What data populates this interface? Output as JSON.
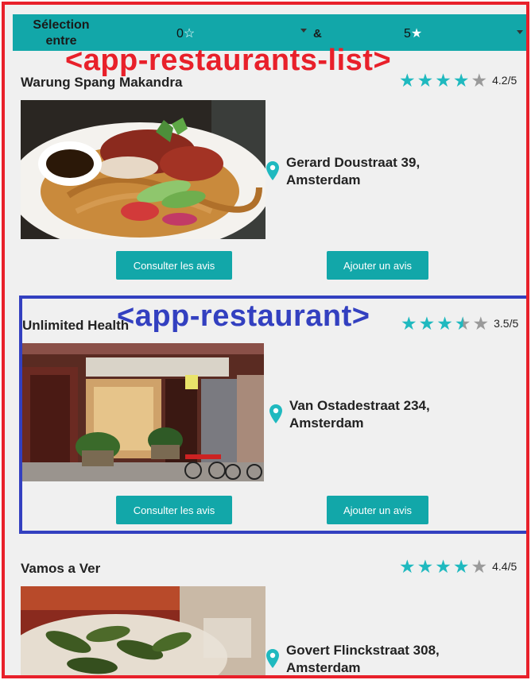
{
  "overlays": {
    "list_component": "<app-restaurants-list>",
    "item_component": "<app-restaurant>"
  },
  "filter": {
    "label": "Sélection entre",
    "min_value": "0",
    "min_icon": "empty-star-icon",
    "separator": "&",
    "max_value": "5",
    "max_icon": "filled-star-icon"
  },
  "common": {
    "view_reviews_label": "Consulter les avis",
    "add_review_label": "Ajouter un avis",
    "location_icon": "map-pin-icon"
  },
  "restaurants": [
    {
      "name": "Warung Spang Makandra",
      "rating": 4.2,
      "rating_text": "4.2/5",
      "address_line1": "Gerard Doustraat 39,",
      "address_line2": "Amsterdam"
    },
    {
      "name": "Unlimited Health",
      "rating": 3.5,
      "rating_text": "3.5/5",
      "address_line1": "Van Ostadestraat 234,",
      "address_line2": "Amsterdam"
    },
    {
      "name": "Vamos a Ver",
      "rating": 4.4,
      "rating_text": "4.4/5",
      "address_line1": "Govert Flinckstraat 308,",
      "address_line2": "Amsterdam"
    }
  ],
  "colors": {
    "accent": "#12a7a9",
    "star": "#1fb9bf",
    "list_outline": "#e8202a",
    "item_outline": "#3340c0"
  }
}
